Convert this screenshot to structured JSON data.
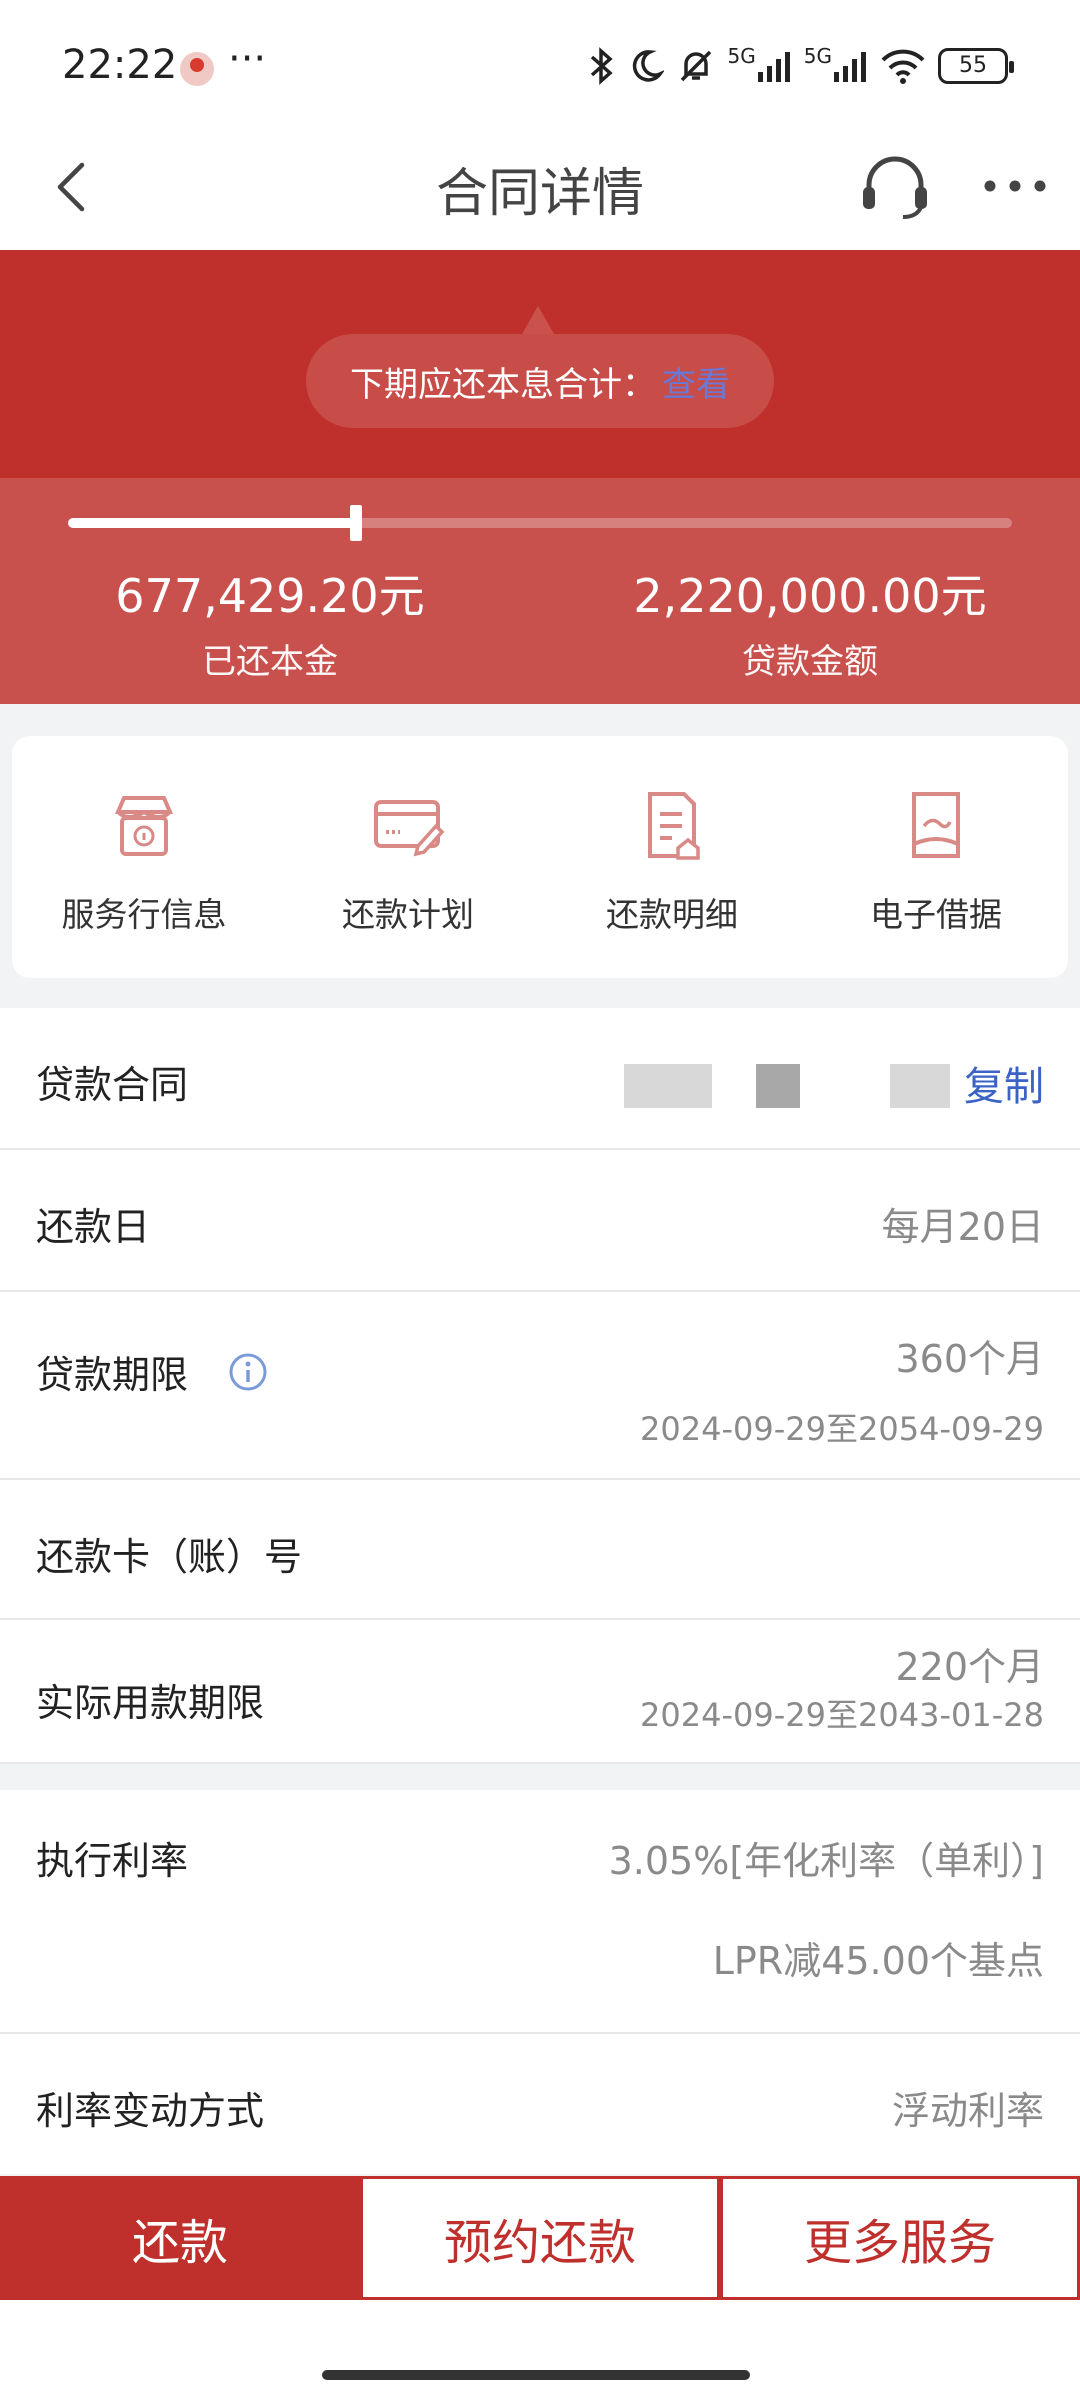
{
  "status_bar": {
    "time": "22:22",
    "dots": "···",
    "battery": "55",
    "network_1": "5G",
    "network_2": "5G"
  },
  "nav": {
    "title": "合同详情"
  },
  "summary": {
    "bubble_text": "下期应还本息合计：",
    "bubble_link": "查看",
    "repaid_principal": "677,429.20元",
    "repaid_principal_label": "已还本金",
    "loan_amount": "2,220,000.00元",
    "loan_amount_label": "贷款金额",
    "repaid_fraction": 0.305
  },
  "services": [
    {
      "label": "服务行信息",
      "icon": "store-info-icon"
    },
    {
      "label": "还款计划",
      "icon": "card-edit-icon"
    },
    {
      "label": "还款明细",
      "icon": "document-detail-icon"
    },
    {
      "label": "电子借据",
      "icon": "e-receipt-icon"
    }
  ],
  "details": {
    "contract_label": "贷款合同",
    "copy_label": "复制",
    "repay_day_label": "还款日",
    "repay_day_value": "每月20日",
    "term_label": "贷款期限",
    "term_value": "360个月",
    "term_range": "2024-09-29至2054-09-29",
    "card_label": "还款卡（账）号",
    "actual_term_label": "实际用款期限",
    "actual_term_value": "220个月",
    "actual_term_range": "2024-09-29至2043-01-28",
    "rate_label": "执行利率",
    "rate_value": "3.05%[年化利率（单利）]",
    "rate_sub": "LPR减45.00个基点",
    "rate_mode_label": "利率变动方式",
    "rate_mode_value": "浮动利率"
  },
  "actions": {
    "repay": "还款",
    "schedule_repay": "预约还款",
    "more_services": "更多服务"
  },
  "colors": {
    "brand_red": "#bf2f2b",
    "link_blue": "#3a63c4"
  }
}
